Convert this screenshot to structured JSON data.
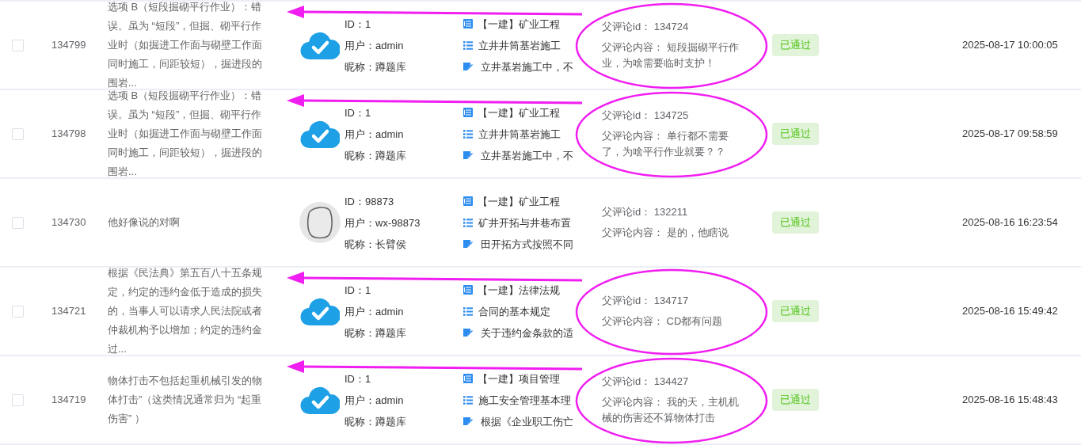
{
  "rows": [
    {
      "checked": false,
      "id": "134799",
      "content": "选项 B（短段掘砌平行作业）：错误。虽为 “短段”，但掘、砌平行作业时（如掘进工作面与砌壁工作面同时施工，间距较短），掘进段的围岩...",
      "avatar": {
        "kind": "cloud"
      },
      "user_id": "ID：1",
      "user": "用户：admin",
      "nickname": "昵称：蹲题库",
      "course": "【一建】矿业工程",
      "chapter": "立井井筒基岩施工",
      "question": "立井基岩施工中，不",
      "parent_id": "父评论id： 134724",
      "parent_content": "父评论内容： 短段掘砌平行作业，为啥需要临时支护！",
      "status": "已通过",
      "time": "2025-08-17 10:00:05",
      "annotated": true
    },
    {
      "checked": false,
      "id": "134798",
      "content": "选项 B（短段掘砌平行作业）：错误。虽为 “短段”，但掘、砌平行作业时（如掘进工作面与砌壁工作面同时施工，间距较短），掘进段的围岩...",
      "avatar": {
        "kind": "cloud"
      },
      "user_id": "ID：1",
      "user": "用户：admin",
      "nickname": "昵称：蹲题库",
      "course": "【一建】矿业工程",
      "chapter": "立井井筒基岩施工",
      "question": "立井基岩施工中，不",
      "parent_id": "父评论id： 134725",
      "parent_content": "父评论内容： 单行都不需要了，为啥平行作业就要？？",
      "status": "已通过",
      "time": "2025-08-17 09:58:59",
      "annotated": true
    },
    {
      "checked": false,
      "id": "134730",
      "content": "他好像说的对啊",
      "avatar": {
        "kind": "blank"
      },
      "user_id": "ID：98873",
      "user": "用户：wx-98873",
      "nickname": "昵称：长臂侯",
      "course": "【一建】矿业工程",
      "chapter": "矿井开拓与井巷布置",
      "question": "田开拓方式按照不同",
      "parent_id": "父评论id： 132211",
      "parent_content": "父评论内容： 是的，他瞎说",
      "status": "已通过",
      "time": "2025-08-16 16:23:54",
      "annotated": false
    },
    {
      "checked": false,
      "id": "134721",
      "content": "根据《民法典》第五百八十五条规定，约定的违约金低于造成的损失的，当事人可以请求人民法院或者仲裁机构予以增加；约定的违约金过...",
      "avatar": {
        "kind": "cloud"
      },
      "user_id": "ID：1",
      "user": "用户：admin",
      "nickname": "昵称：蹲题库",
      "course": "【一建】法律法规",
      "chapter": "合同的基本规定",
      "question": "关于违约金条款的适",
      "parent_id": "父评论id： 134717",
      "parent_content": "父评论内容： CD都有问题",
      "status": "已通过",
      "time": "2025-08-16 15:49:42",
      "annotated": true
    },
    {
      "checked": false,
      "id": "134719",
      "content": "物体打击不包括起重机械引发的物体打击”（这类情况通常归为 “起重伤害” ）",
      "avatar": {
        "kind": "cloud"
      },
      "user_id": "ID：1",
      "user": "用户：admin",
      "nickname": "昵称：蹲题库",
      "course": "【一建】项目管理",
      "chapter": "施工安全管理基本理",
      "question": "根据《企业职工伤亡",
      "parent_id": "父评论id： 134427",
      "parent_content": "父评论内容： 我的天，主机机械的伤害还不算物体打击",
      "status": "已通过",
      "time": "2025-08-16 15:48:43",
      "annotated": true
    }
  ]
}
